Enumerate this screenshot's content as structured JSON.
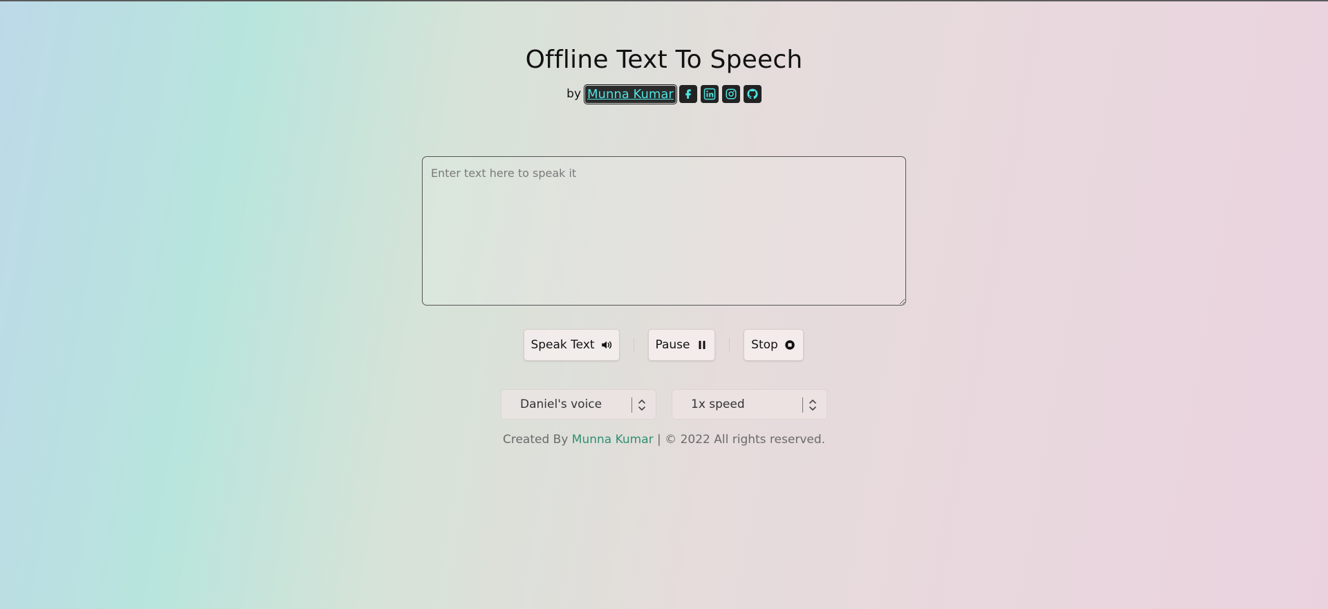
{
  "header": {
    "title": "Offline Text To Speech",
    "by_label": "by",
    "author": "Munna Kumar",
    "social": [
      {
        "icon": "facebook-icon"
      },
      {
        "icon": "linkedin-icon"
      },
      {
        "icon": "instagram-icon"
      },
      {
        "icon": "github-icon"
      }
    ]
  },
  "input": {
    "placeholder": "Enter text here to speak it",
    "value": ""
  },
  "controls": {
    "speak_label": "Speak Text",
    "pause_label": "Pause",
    "stop_label": "Stop"
  },
  "selects": {
    "voice": "Daniel's voice",
    "speed": "1x speed"
  },
  "footer": {
    "prefix": "Created By",
    "name": "Munna Kumar",
    "suffix": "| © 2022 All rights reserved."
  },
  "colors": {
    "author_link_bg": "#2b2b2b",
    "author_link_text": "#4fe3e3",
    "footer_name": "#2f8f72"
  }
}
